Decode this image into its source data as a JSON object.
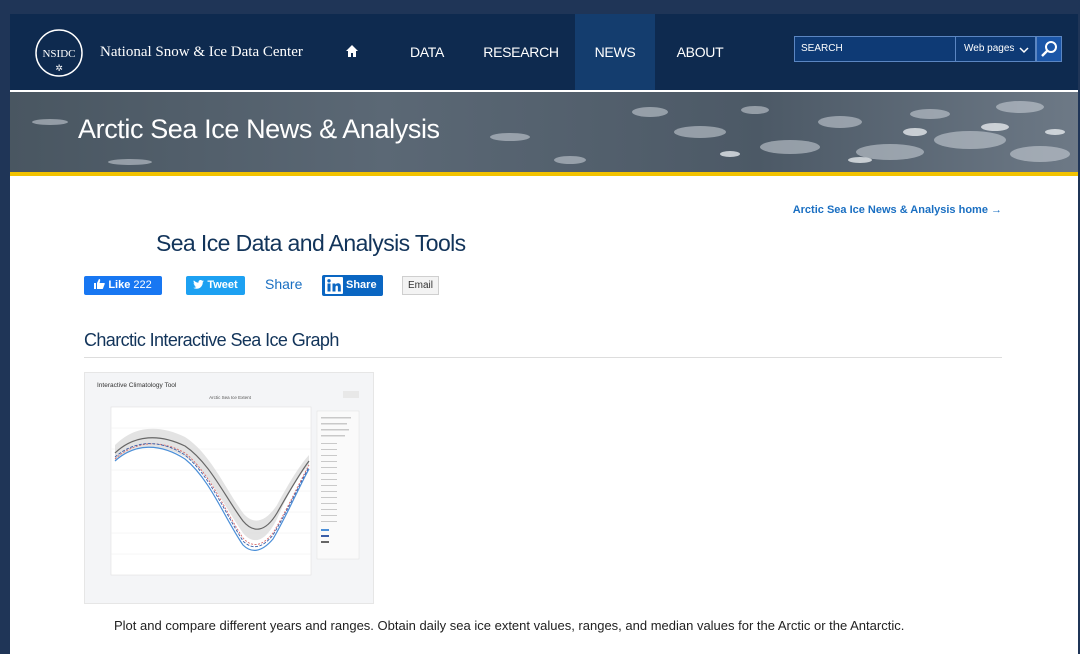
{
  "header": {
    "logo_text": "NSIDC",
    "site_name": "National Snow & Ice Data Center",
    "nav": [
      {
        "label": "DATA"
      },
      {
        "label": "RESEARCH"
      },
      {
        "label": "NEWS"
      },
      {
        "label": "ABOUT"
      }
    ],
    "active_nav": "NEWS",
    "search_placeholder": "SEARCH",
    "search_scope": "Web pages"
  },
  "banner": {
    "title": "Arctic Sea Ice News & Analysis"
  },
  "main": {
    "home_link": "Arctic Sea Ice News & Analysis home →",
    "title": "Sea Ice Data and Analysis Tools",
    "social": {
      "like_label": "Like",
      "like_count": "222",
      "tweet_label": "Tweet",
      "share_label": "Share",
      "linkedin_label": "Share",
      "email_label": "Email"
    },
    "section": {
      "title": "Charctic Interactive Sea Ice Graph",
      "thumb_heading": "Interactive Climatology Tool",
      "thumb_chart_title": "Arctic Sea Ice Extent",
      "description": "Plot and compare different years and ranges. Obtain daily sea ice extent values, ranges, and median values for the Arctic or the Antarctic."
    }
  },
  "colors": {
    "nav_bg": "#0e2a4f",
    "active_nav_bg": "#143d6e",
    "accent_yellow": "#f2c200",
    "link_blue": "#1a6fc2",
    "title_navy": "#12345a"
  },
  "icons": {
    "home": "home-icon",
    "search": "search-icon",
    "dropdown": "chevron-down-icon",
    "like": "thumbs-up-icon",
    "twitter": "twitter-icon",
    "linkedin": "linkedin-icon"
  }
}
